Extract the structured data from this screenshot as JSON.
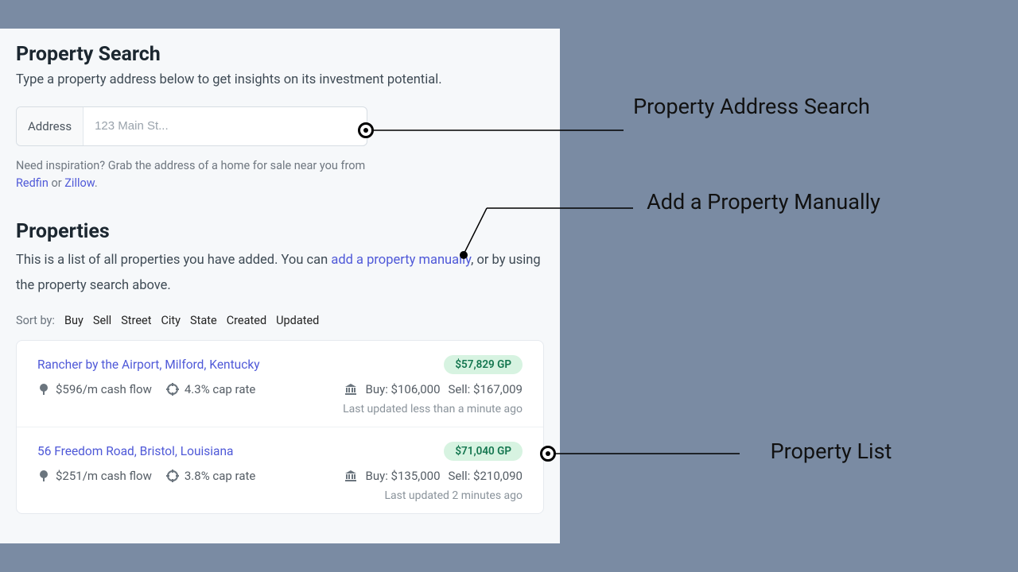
{
  "search": {
    "heading": "Property Search",
    "subtext": "Type a property address below to get insights on its investment potential.",
    "address_label": "Address",
    "placeholder": "123 Main St...",
    "hint_prefix": "Need inspiration? Grab the address of a home for sale near you from ",
    "redfin": "Redfin",
    "or": " or ",
    "zillow": "Zillow",
    "hint_suffix": "."
  },
  "properties": {
    "heading": "Properties",
    "desc_prefix": "This is a list of all properties you have added. You can ",
    "add_link": "add a property manually",
    "desc_suffix": ", or by using the property search above.",
    "sort_label": "Sort by:",
    "sort_options": [
      "Buy",
      "Sell",
      "Street",
      "City",
      "State",
      "Created",
      "Updated"
    ]
  },
  "cards": [
    {
      "title": "Rancher by the Airport, Milford, Kentucky",
      "gp": "$57,829 GP",
      "cashflow": "$596/m cash flow",
      "cap": "4.3% cap rate",
      "buy": "Buy: $106,000",
      "sell": "Sell: $167,009",
      "updated": "Last updated less than a minute ago"
    },
    {
      "title": "56 Freedom Road, Bristol, Louisiana",
      "gp": "$71,040 GP",
      "cashflow": "$251/m cash flow",
      "cap": "3.8% cap rate",
      "buy": "Buy: $135,000",
      "sell": "Sell: $210,090",
      "updated": "Last updated 2 minutes ago"
    }
  ],
  "annotations": {
    "a1": "Property Address Search",
    "a2": "Add a Property Manually",
    "a3": "Property List"
  }
}
